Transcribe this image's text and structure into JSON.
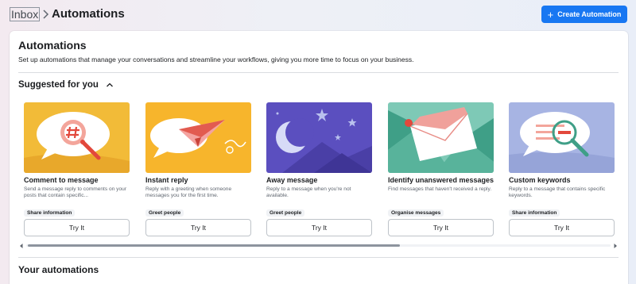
{
  "breadcrumb": {
    "parent": "Inbox",
    "current": "Automations"
  },
  "header": {
    "create_button": "Create Automation"
  },
  "page": {
    "title": "Automations",
    "description": "Set up automations that manage your conversations and streamline your workflows, giving you more time to focus on your business."
  },
  "suggested": {
    "label": "Suggested for you",
    "cards": [
      {
        "title": "Comment to message",
        "description": "Send a message reply to comments on your posts that contain specific...",
        "tag": "Share information",
        "button": "Try It",
        "bg": "#f2bb38"
      },
      {
        "title": "Instant reply",
        "description": "Reply with a greeting when someone messages you for the first time.",
        "tag": "Greet people",
        "button": "Try It",
        "bg": "#f7b52c"
      },
      {
        "title": "Away message",
        "description": "Reply to a message when you're not available.",
        "tag": "Greet people",
        "button": "Try It",
        "bg": "#5b4fbf"
      },
      {
        "title": "Identify unanswered messages",
        "description": "Find messages that haven't received a reply.",
        "tag": "Organise messages",
        "button": "Try It",
        "bg": "#4cb8a0"
      },
      {
        "title": "Custom keywords",
        "description": "Reply to a message that contains specific keywords.",
        "tag": "Share information",
        "button": "Try It",
        "bg": "#a7b4e3"
      }
    ]
  },
  "your_automations": {
    "label": "Your automations"
  },
  "colors": {
    "accent": "#1877f2",
    "divider": "#dadde1",
    "tag_bg": "#f0f2f5"
  }
}
